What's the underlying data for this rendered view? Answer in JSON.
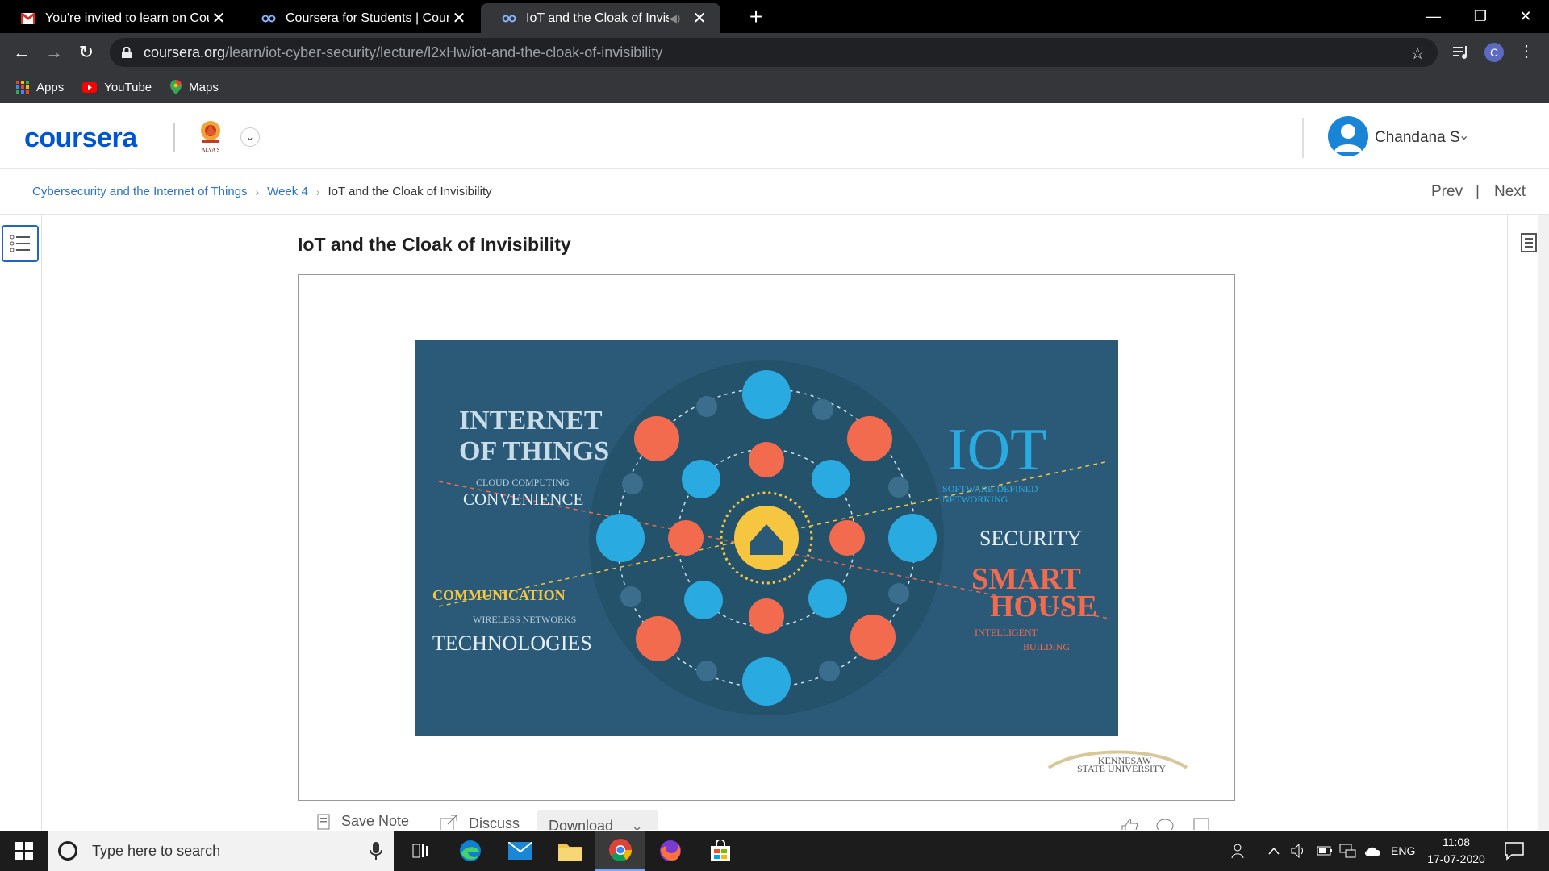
{
  "browser": {
    "tabs": [
      {
        "title": "You're invited to learn on Coursera",
        "icon": "gmail-icon",
        "active": false
      },
      {
        "title": "Coursera for Students | Coursera",
        "icon": "coursera-tab-icon",
        "active": false
      },
      {
        "title": "IoT and the Cloak of Invisibility",
        "icon": "coursera-tab-icon",
        "active": true
      }
    ],
    "url_host": "coursera.org",
    "url_path": "/learn/iot-cyber-security/lecture/l2xHw/iot-and-the-cloak-of-invisibility",
    "profile_initial": "C",
    "bookmarks": [
      {
        "label": "Apps",
        "icon": "apps-grid-icon"
      },
      {
        "label": "YouTube",
        "icon": "youtube-icon"
      },
      {
        "label": "Maps",
        "icon": "maps-pin-icon"
      }
    ]
  },
  "header": {
    "logo_text": "coursera",
    "org_logo_text": "ALVA'S",
    "user_name": "Chandana S"
  },
  "breadcrumb": {
    "course": "Cybersecurity and the Internet of Things",
    "week": "Week 4",
    "current": "IoT and the Cloak of Invisibility",
    "prev": "Prev",
    "separator": "|",
    "next": "Next"
  },
  "lecture": {
    "title": "IoT and the Cloak of Invisibility",
    "slide": {
      "left_heading_1": "INTERNET",
      "left_heading_2": "OF THINGS",
      "cloud_computing": "CLOUD COMPUTING",
      "convenience": "CONVENIENCE",
      "communication": "COMMUNICATION",
      "wireless_networks": "WIRELESS NETWORKS",
      "technologies": "TECHNOLOGIES",
      "iot": "IOT",
      "sdn_1": "SOFTWARE-DEFINED",
      "sdn_2": "NETWORKING",
      "security": "SECURITY",
      "smart": "SMART",
      "house": "HOUSE",
      "intelligent": "INTELLIGENT",
      "building": "BUILDING"
    },
    "watermark_1": "KENNESAW",
    "watermark_2": "STATE UNIVERSITY"
  },
  "actions": {
    "save_note": "Save Note",
    "discuss": "Discuss",
    "download": "Download"
  },
  "taskbar": {
    "search_placeholder": "Type here to search",
    "lang": "ENG",
    "time": "11:08",
    "date": "17-07-2020"
  },
  "colors": {
    "coursera_blue": "#0056d2",
    "link_blue": "#2a73cc",
    "slide_bg": "#2b5a78",
    "slide_cyan": "#29abe2",
    "slide_orange": "#f26b4f",
    "slide_yellow": "#f7c640"
  }
}
